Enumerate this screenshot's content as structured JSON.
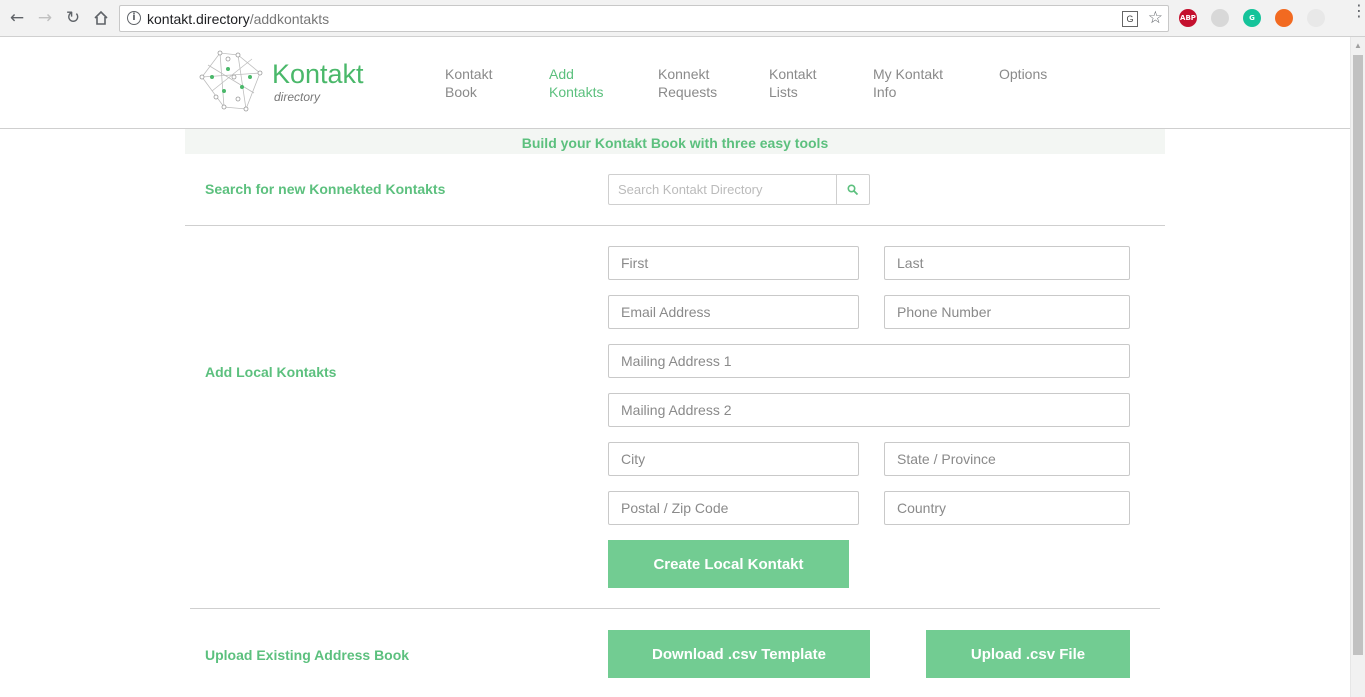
{
  "browser": {
    "url_host": "kontakt.directory",
    "url_path": "/addkontakts",
    "translate_glyph": "G",
    "extensions": [
      {
        "name": "adblock-plus-icon",
        "label": "ABP",
        "color": "#c4102e"
      },
      {
        "name": "ghost-extension-icon",
        "label": "",
        "color": "#d8d8d8"
      },
      {
        "name": "grammarly-icon",
        "label": "G",
        "color": "#15c39a"
      },
      {
        "name": "support-lifebuoy-icon",
        "label": "",
        "color": "#f26a21"
      },
      {
        "name": "eyedropper-icon",
        "label": "",
        "color": "#e8e8e8"
      }
    ]
  },
  "header": {
    "logo_word": "Kontakt",
    "logo_sub": "directory",
    "nav": [
      {
        "label": "Kontakt\nBook",
        "active": false
      },
      {
        "label": "Add\nKontakts",
        "active": true
      },
      {
        "label": "Konnekt\nRequests",
        "active": false
      },
      {
        "label": "Kontakt\nLists",
        "active": false
      },
      {
        "label": "My Kontakt\nInfo",
        "active": false
      },
      {
        "label": "Options",
        "active": false
      }
    ]
  },
  "banner": "Build your Kontakt Book with three easy tools",
  "search_section": {
    "label": "Search for new Konnekted Kontakts",
    "placeholder": "Search Kontakt Directory"
  },
  "local_section": {
    "label": "Add Local Kontakts",
    "fields": {
      "first": "First",
      "last": "Last",
      "email": "Email Address",
      "phone": "Phone Number",
      "address1": "Mailing Address 1",
      "address2": "Mailing Address 2",
      "city": "City",
      "state": "State / Province",
      "postal": "Postal / Zip Code",
      "country": "Country"
    },
    "create_button": "Create Local Kontakt"
  },
  "upload_section": {
    "label": "Upload Existing Address Book",
    "download_button": "Download .csv Template",
    "upload_button": "Upload .csv File"
  },
  "colors": {
    "accent": "#5cc07e",
    "button": "#72cc92"
  }
}
